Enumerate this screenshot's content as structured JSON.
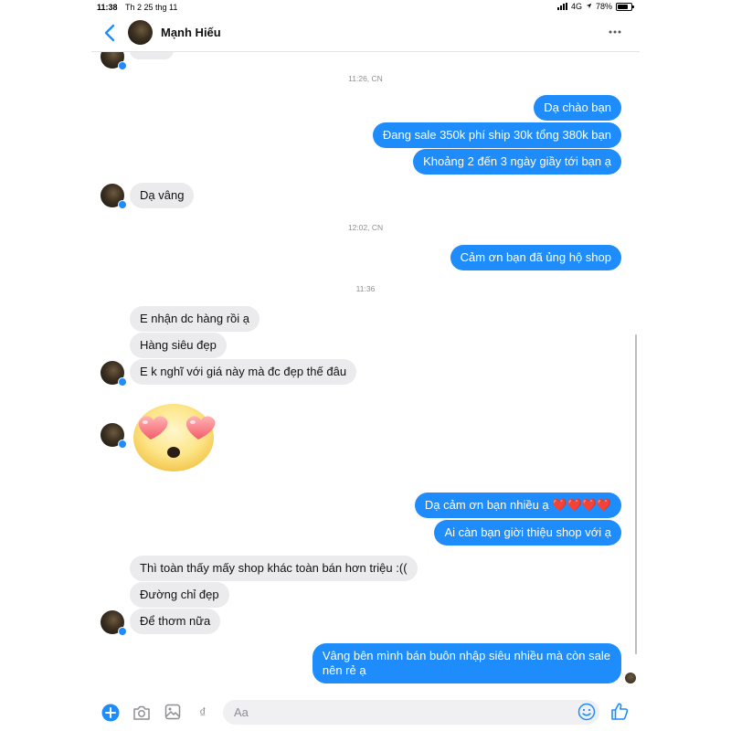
{
  "status_bar": {
    "time": "11:38",
    "date": "Th 2 25 thg 11",
    "network": "4G",
    "battery": "78%",
    "battery_level": 0.78
  },
  "header": {
    "contact_name": "Mạnh Hiếu"
  },
  "timestamps": [
    "11:26, CN",
    "12:02, CN",
    "11:36"
  ],
  "messages": {
    "out_1": "Dạ chào bạn",
    "out_2": "Đang sale 350k phí ship 30k tổng 380k bạn",
    "out_3": "Khoảng 2 đến 3 ngày giầy tới bạn ạ",
    "in_1": "Dạ vâng",
    "out_4": "Cảm ơn bạn đã ủng hộ shop",
    "in_2": "E nhận dc hàng rồi ạ",
    "in_3": "Hàng siêu đẹp",
    "in_4": "E k nghĩ với giá này mà đc đẹp thế đâu",
    "out_5": "Dạ cảm ơn bạn nhiều ạ ❤️❤️❤️❤️",
    "out_6": "Ai càn bạn giời thiệu shop với ạ",
    "in_5": "Thì toàn thấy mấy shop khác toàn bán hơn triệu :((",
    "in_6": "Đường chỉ đẹp",
    "in_7": "Để thơm nữa",
    "out_7_line1": "Vâng bên mình bán buôn nhập siêu nhiều mà còn sale",
    "out_7_line2": "nên rẻ ạ"
  },
  "composer": {
    "placeholder": "Aa"
  },
  "icons": [
    "back-chevron-icon",
    "more-icon",
    "plus-icon",
    "camera-icon",
    "image-icon",
    "dong-icon",
    "emoji-icon",
    "like-icon"
  ],
  "colors": {
    "accent": "#1e8cfa",
    "incoming_bubble": "#ebebed"
  }
}
